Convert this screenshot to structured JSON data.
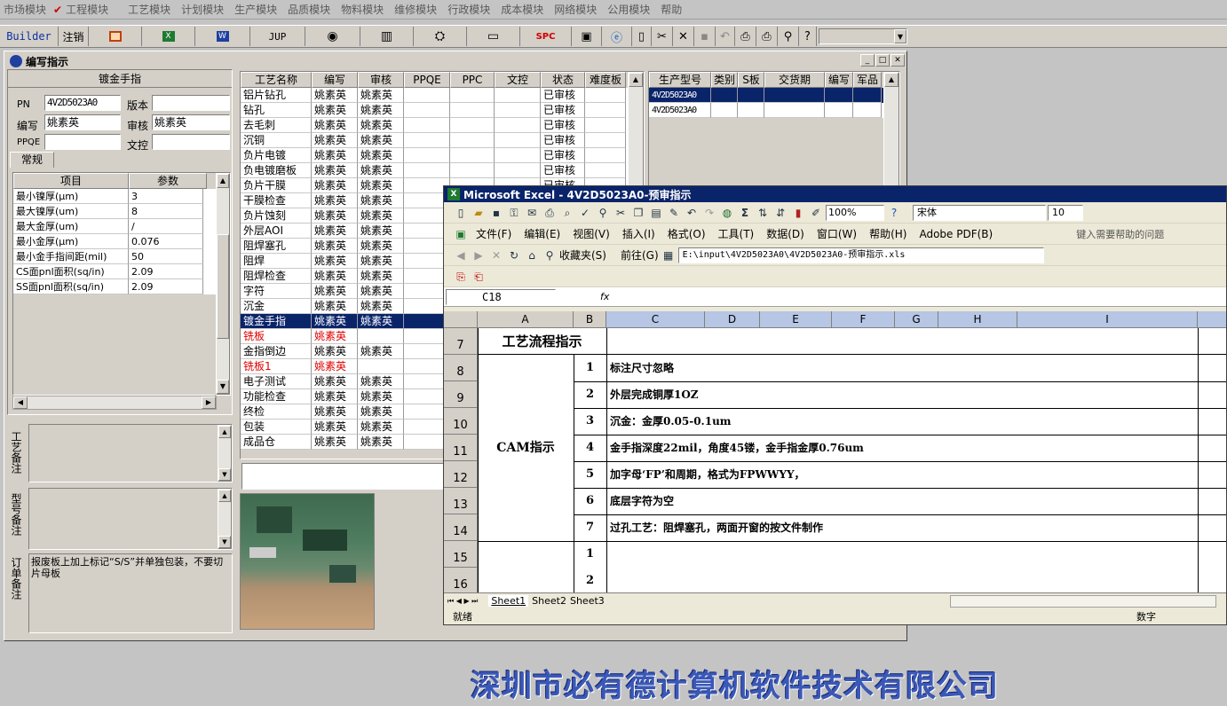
{
  "menubar": [
    "市场模块",
    "工程模块",
    "工艺模块",
    "计划模块",
    "生产模块",
    "品质模块",
    "物料模块",
    "维修模块",
    "行政模块",
    "成本模块",
    "网络模块",
    "公用模块",
    "帮助"
  ],
  "toolbar": {
    "builder": "Builder",
    "logout": "注销",
    "jup": "JUP",
    "spc": "SPC"
  },
  "window": {
    "title": "编写指示"
  },
  "left": {
    "title": "镀金手指",
    "pn_label": "PN",
    "pn_value": "4V2D5023A0",
    "ver_label": "版本",
    "ver_value": "",
    "writer_label": "编写",
    "writer_value": "姚素英",
    "review_label": "审核",
    "review_value": "姚素英",
    "ppqe_label": "PPQE",
    "ppqe_value": "",
    "doc_label": "文控",
    "doc_value": "",
    "tab": "常规",
    "param_headers": [
      "项目",
      "参数"
    ],
    "params": [
      [
        "最小镍厚(μm)",
        "3"
      ],
      [
        "最大镍厚(um)",
        "8"
      ],
      [
        "最大金厚(um)",
        "/"
      ],
      [
        "最小金厚(μm)",
        "0.076"
      ],
      [
        "最小金手指间距(mil)",
        "50"
      ],
      [
        "CS面pnl面积(sq/in)",
        "2.09"
      ],
      [
        "SS面pnl面积(sq/in)",
        "2.09"
      ]
    ],
    "note1_label": "工艺备注",
    "note2_label": "型号备注",
    "note3_label": "订单备注",
    "order_note": "报废板上加上标记“S/S”并单独包装，不要切片母板"
  },
  "process": {
    "headers": [
      "工艺名称",
      "编写",
      "审核",
      "PPQE",
      "PPC",
      "文控",
      "状态",
      "难度板"
    ],
    "rows": [
      [
        "铝片钻孔",
        "姚素英",
        "姚素英",
        "",
        "",
        "",
        "已审核",
        ""
      ],
      [
        "钻孔",
        "姚素英",
        "姚素英",
        "",
        "",
        "",
        "已审核",
        ""
      ],
      [
        "去毛刺",
        "姚素英",
        "姚素英",
        "",
        "",
        "",
        "已审核",
        ""
      ],
      [
        "沉铜",
        "姚素英",
        "姚素英",
        "",
        "",
        "",
        "已审核",
        ""
      ],
      [
        "负片电镀",
        "姚素英",
        "姚素英",
        "",
        "",
        "",
        "已审核",
        ""
      ],
      [
        "负电镀磨板",
        "姚素英",
        "姚素英",
        "",
        "",
        "",
        "已审核",
        ""
      ],
      [
        "负片干膜",
        "姚素英",
        "姚素英",
        "",
        "",
        "",
        "已审核",
        ""
      ],
      [
        "干膜检查",
        "姚素英",
        "姚素英",
        "",
        "",
        "",
        "",
        ""
      ],
      [
        "负片蚀刻",
        "姚素英",
        "姚素英",
        "",
        "",
        "",
        "",
        ""
      ],
      [
        "外层AOI",
        "姚素英",
        "姚素英",
        "",
        "",
        "",
        "",
        ""
      ],
      [
        "阻焊塞孔",
        "姚素英",
        "姚素英",
        "",
        "",
        "",
        "",
        ""
      ],
      [
        "阻焊",
        "姚素英",
        "姚素英",
        "",
        "",
        "",
        "",
        ""
      ],
      [
        "阻焊检查",
        "姚素英",
        "姚素英",
        "",
        "",
        "",
        "",
        ""
      ],
      [
        "字符",
        "姚素英",
        "姚素英",
        "",
        "",
        "",
        "",
        ""
      ],
      [
        "沉金",
        "姚素英",
        "姚素英",
        "",
        "",
        "",
        "",
        ""
      ],
      [
        "镀金手指",
        "姚素英",
        "姚素英",
        "",
        "",
        "",
        "",
        ""
      ],
      [
        "铣板",
        "姚素英",
        "",
        "",
        "",
        "",
        "",
        ""
      ],
      [
        "金指倒边",
        "姚素英",
        "姚素英",
        "",
        "",
        "",
        "",
        ""
      ],
      [
        "铣板1",
        "姚素英",
        "",
        "",
        "",
        "",
        "",
        ""
      ],
      [
        "电子测试",
        "姚素英",
        "姚素英",
        "",
        "",
        "",
        "",
        ""
      ],
      [
        "功能检查",
        "姚素英",
        "姚素英",
        "",
        "",
        "",
        "",
        ""
      ],
      [
        "终检",
        "姚素英",
        "姚素英",
        "",
        "",
        "",
        "",
        ""
      ],
      [
        "包装",
        "姚素英",
        "姚素英",
        "",
        "",
        "",
        "",
        ""
      ],
      [
        "成品仓",
        "姚素英",
        "姚素英",
        "",
        "",
        "",
        "",
        ""
      ]
    ]
  },
  "product": {
    "headers": [
      "生产型号",
      "类别",
      "S板",
      "交货期",
      "编写",
      "军品"
    ],
    "rows": [
      [
        "4V2D5023A0",
        "",
        "",
        "",
        "",
        ""
      ],
      [
        "4V2D5023A0",
        "",
        "",
        "",
        "",
        ""
      ]
    ]
  },
  "excel": {
    "title": "Microsoft Excel - 4V2D5023A0-预审指示",
    "menu": [
      "文件(F)",
      "编辑(E)",
      "视图(V)",
      "插入(I)",
      "格式(O)",
      "工具(T)",
      "数据(D)",
      "窗口(W)",
      "帮助(H)",
      "Adobe PDF(B)"
    ],
    "help_placeholder": "键入需要帮助的问题",
    "zoom": "100%",
    "font": "宋体",
    "size": "10",
    "favorites": "收藏夹(S)",
    "goto": "前往(G)",
    "path": "E:\\input\\4V2D5023A0\\4V2D5023A0-预审指示.xls",
    "namebox": "C18",
    "fx": "fx",
    "cols": [
      "A",
      "B",
      "C",
      "D",
      "E",
      "F",
      "G",
      "H",
      "I"
    ],
    "rownums": [
      "7",
      "8",
      "9",
      "10",
      "11",
      "12",
      "13",
      "14",
      "15",
      "16"
    ],
    "r7": "工艺流程指示",
    "cam": "CAM指示",
    "items": [
      [
        "1",
        "标注尺寸忽略"
      ],
      [
        "2",
        "外层完成铜厚1OZ"
      ],
      [
        "3",
        "沉金：金厚0.05-0.1um"
      ],
      [
        "4",
        "金手指深度22mil，角度45镂，金手指金厚0.76um"
      ],
      [
        "5",
        "加字母‘FP’和周期，格式为FPWWYY，"
      ],
      [
        "6",
        "底层字符为空"
      ],
      [
        "7",
        "过孔工艺：阻焊塞孔，两面开窗的按文件制作"
      ]
    ],
    "extra": [
      "1",
      "2"
    ],
    "sheets": [
      "Sheet1",
      "Sheet2",
      "Sheet3"
    ],
    "status": "就绪",
    "status_right": "数字"
  },
  "footer": "深圳市必有德计算机软件技术有限公司",
  "colors": {
    "selection": "#0a246a",
    "titlebar": "#0a246a",
    "footer": "#3a58b8",
    "red": "#e00000"
  }
}
